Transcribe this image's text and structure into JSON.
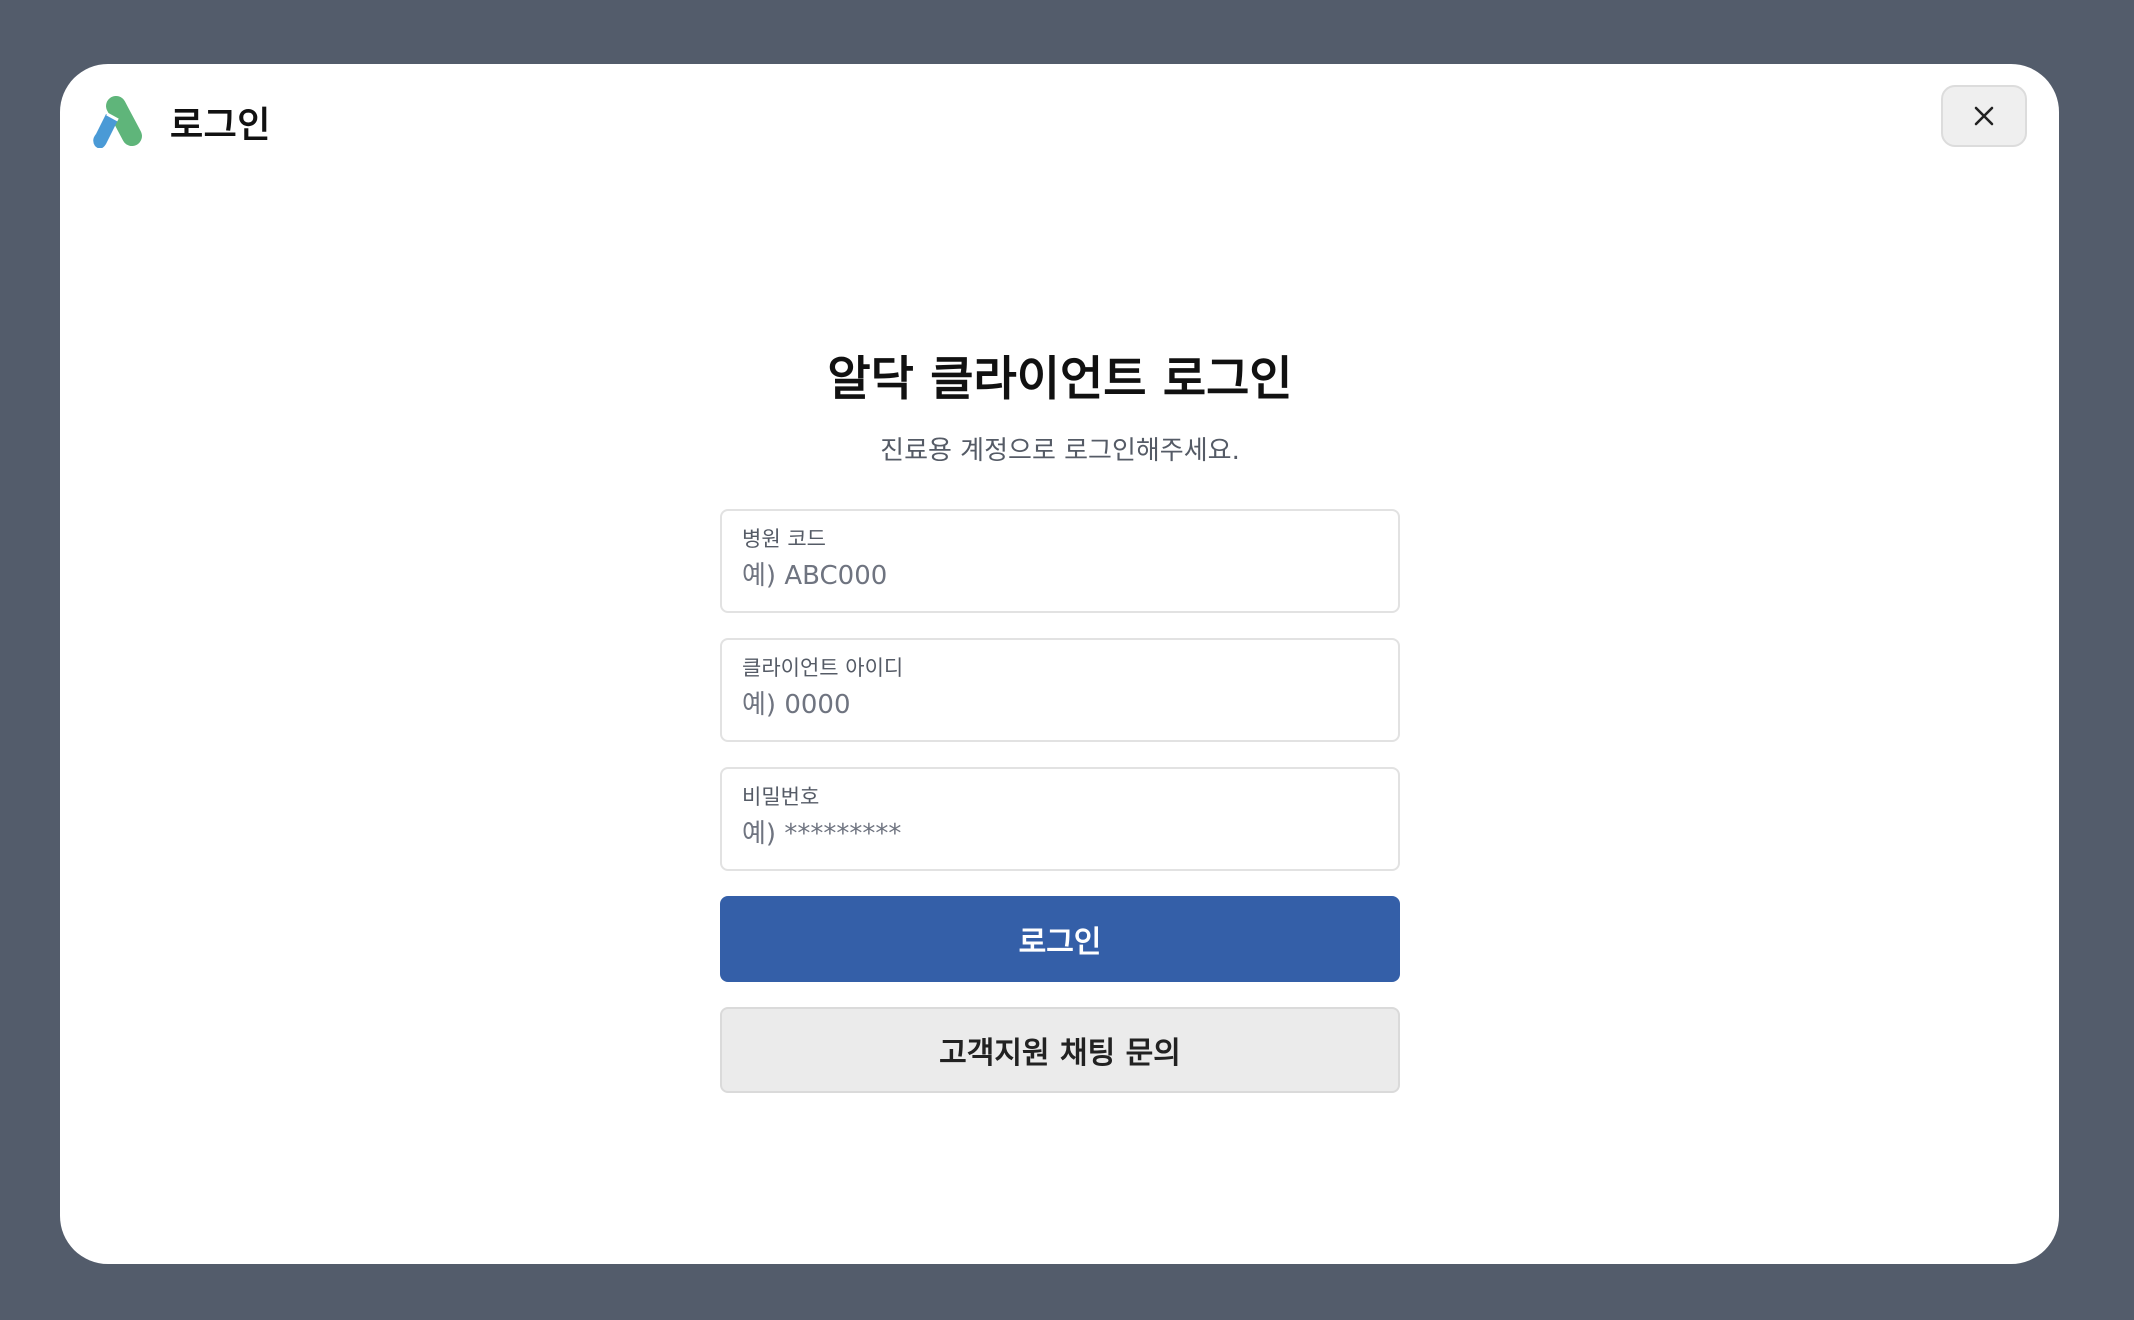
{
  "header": {
    "title": "로그인",
    "logo_icon": "pill-logo-icon",
    "close_icon": "close-icon"
  },
  "main": {
    "title": "알닥 클라이언트 로그인",
    "subtitle": "진료용 계정으로 로그인해주세요."
  },
  "form": {
    "hospital_code": {
      "label": "병원 코드",
      "placeholder": "예) ABC000",
      "value": ""
    },
    "client_id": {
      "label": "클라이언트 아이디",
      "placeholder": "예) 0000",
      "value": ""
    },
    "password": {
      "label": "비밀번호",
      "placeholder": "예) *********",
      "value": ""
    },
    "login_label": "로그인",
    "support_label": "고객지원 채팅 문의"
  },
  "colors": {
    "backdrop": "#535c6b",
    "primary": "#345fa8",
    "logo_blue": "#4a9ad6",
    "logo_green": "#5fb57a"
  }
}
